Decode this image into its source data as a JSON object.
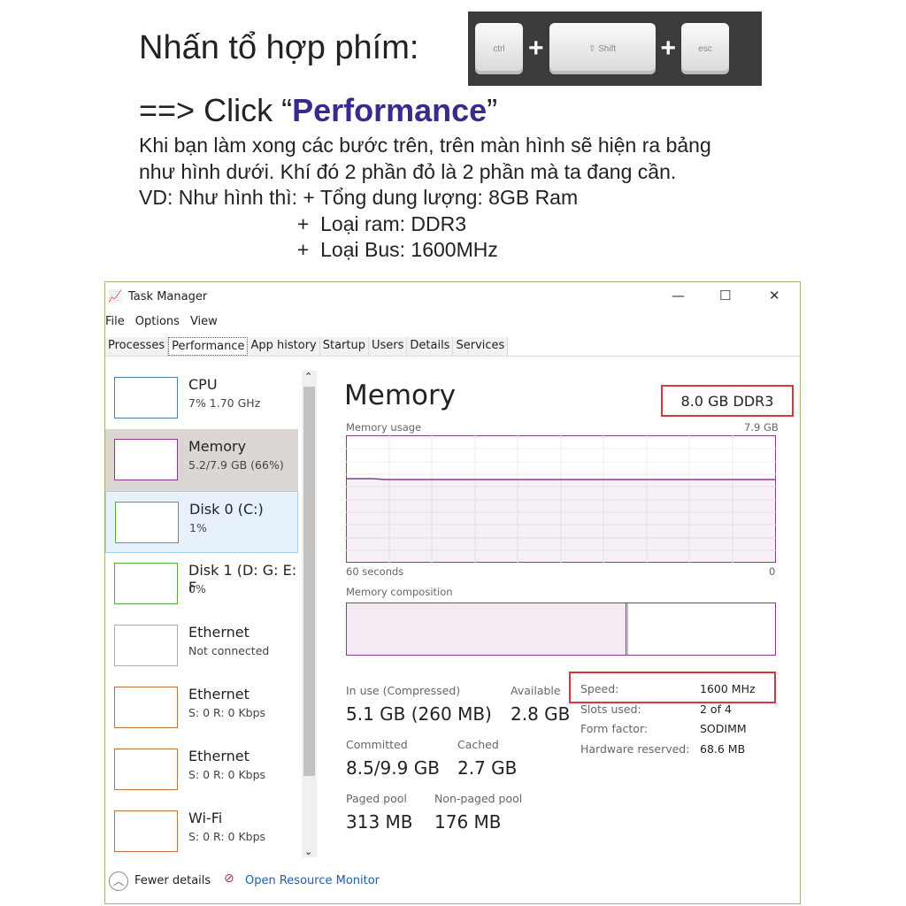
{
  "instructions": {
    "heading": "Nhấn tổ hợp phím:",
    "keys": [
      "ctrl",
      "Shift",
      "esc"
    ],
    "plus": "+",
    "click_prefix": "==> Click “",
    "click_target": "Performance",
    "click_suffix": "”",
    "lines": [
      "Khi bạn làm xong các bước trên, trên màn hình sẽ hiện ra bảng",
      "như hình dưới. Khí đó 2 phần đỏ là 2 phần mà ta đang cần.",
      "VD: Như hình thì: + Tổng dung lượng: 8GB Ram",
      "                            +  Loại ram: DDR3",
      "                            +  Loại Bus: 1600MHz"
    ]
  },
  "window": {
    "title": "Task Manager",
    "menu": [
      "File",
      "Options",
      "View"
    ],
    "tabs": [
      "Processes",
      "Performance",
      "App history",
      "Startup",
      "Users",
      "Details",
      "Services"
    ],
    "active_tab": "Performance",
    "sidebar": [
      {
        "name": "CPU",
        "sub": "7% 1.70 GHz",
        "color": "#4a7fb5"
      },
      {
        "name": "Memory",
        "sub": "5.2/7.9 GB (66%)",
        "color": "#8b3a8b"
      },
      {
        "name": "Disk 0 (C:)",
        "sub": "1%",
        "color": "#4caf3c"
      },
      {
        "name": "Disk 1 (D: G: E: F",
        "sub": "0%",
        "color": "#4caf3c"
      },
      {
        "name": "Ethernet",
        "sub": "Not connected",
        "color": "#aaaaaa"
      },
      {
        "name": "Ethernet",
        "sub": "S: 0 R: 0 Kbps",
        "color": "#c0703a"
      },
      {
        "name": "Ethernet",
        "sub": "S: 0 R: 0 Kbps",
        "color": "#c0703a"
      },
      {
        "name": "Wi-Fi",
        "sub": "S: 0 R: 0 Kbps",
        "color": "#c0703a"
      }
    ],
    "main": {
      "title": "Memory",
      "type": "8.0 GB DDR3",
      "usage_label": "Memory usage",
      "usage_max": "7.9 GB",
      "time_left": "60 seconds",
      "time_right": "0",
      "composition_label": "Memory composition",
      "in_use_label": "In use (Compressed)",
      "in_use": "5.1 GB (260 MB)",
      "available_label": "Available",
      "available": "2.8 GB",
      "committed_label": "Committed",
      "committed": "8.5/9.9 GB",
      "cached_label": "Cached",
      "cached": "2.7 GB",
      "paged_label": "Paged pool",
      "paged": "313 MB",
      "nonpaged_label": "Non-paged pool",
      "nonpaged": "176 MB",
      "specs": [
        [
          "Speed:",
          "1600 MHz"
        ],
        [
          "Slots used:",
          "2 of 4"
        ],
        [
          "Form factor:",
          "SODIMM"
        ],
        [
          "Hardware reserved:",
          "68.6 MB"
        ]
      ]
    },
    "footer": {
      "fewer": "Fewer details",
      "monitor": "Open Resource Monitor"
    },
    "accent": "#8b3a8b",
    "highlight": "#d9363e"
  }
}
